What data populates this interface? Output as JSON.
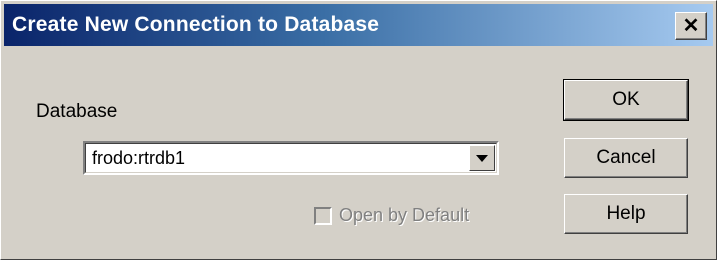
{
  "dialog": {
    "title": "Create New Connection to Database",
    "close_glyph": "✕",
    "database_label": "Database",
    "database_value": "frodo:rtrdb1",
    "open_by_default_label": "Open by Default",
    "open_by_default_checked": false,
    "buttons": {
      "ok": "OK",
      "cancel": "Cancel",
      "help": "Help"
    }
  },
  "colors": {
    "title_gradient_start": "#0a246a",
    "title_gradient_end": "#a6caf0",
    "face": "#d4d0c8",
    "disabled_text": "#808080"
  },
  "icons": {
    "close": "close-icon",
    "dropdown": "chevron-down-icon"
  }
}
